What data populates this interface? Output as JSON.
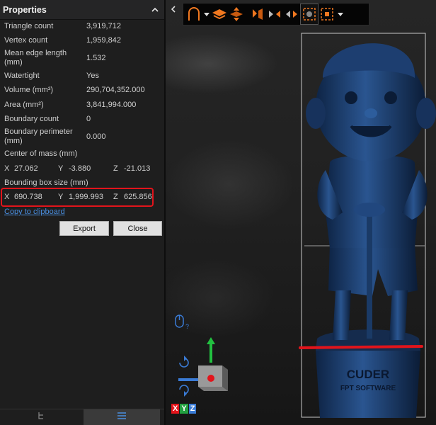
{
  "panel": {
    "title": "Properties",
    "properties": [
      {
        "label": "Triangle count",
        "value": "3,919,712"
      },
      {
        "label": "Vertex count",
        "value": "1,959,842"
      },
      {
        "label": "Mean edge length (mm)",
        "value": "1.532"
      },
      {
        "label": "Watertight",
        "value": "Yes"
      },
      {
        "label": "Volume (mm³)",
        "value": "290,704,352.000"
      },
      {
        "label": "Area (mm²)",
        "value": "3,841,994.000"
      },
      {
        "label": "Boundary count",
        "value": "0"
      },
      {
        "label": "Boundary perimeter (mm)",
        "value": "0.000"
      }
    ],
    "center_of_mass": {
      "label": "Center of mass (mm)",
      "x_label": "X",
      "x": "27.062",
      "y_label": "Y",
      "y": "-3.880",
      "z_label": "Z",
      "z": "-21.013"
    },
    "bounding_box": {
      "label": "Bounding box size (mm)",
      "x_label": "X",
      "x": "690.738",
      "y_label": "Y",
      "y": "1,999.993",
      "z_label": "Z",
      "z": "625.856"
    },
    "copy_link": "Copy to clipboard",
    "export_button": "Export",
    "close_button": "Close"
  },
  "model": {
    "sign_line1": "CUDER",
    "sign_line2": "FPT SOFTWARE"
  },
  "gizmo": {
    "x": "X",
    "y": "Y",
    "z": "Z"
  },
  "colors": {
    "highlight": "#e2141b",
    "accent": "#f07820",
    "link": "#4a8fe0",
    "model": "#1a3a66"
  }
}
